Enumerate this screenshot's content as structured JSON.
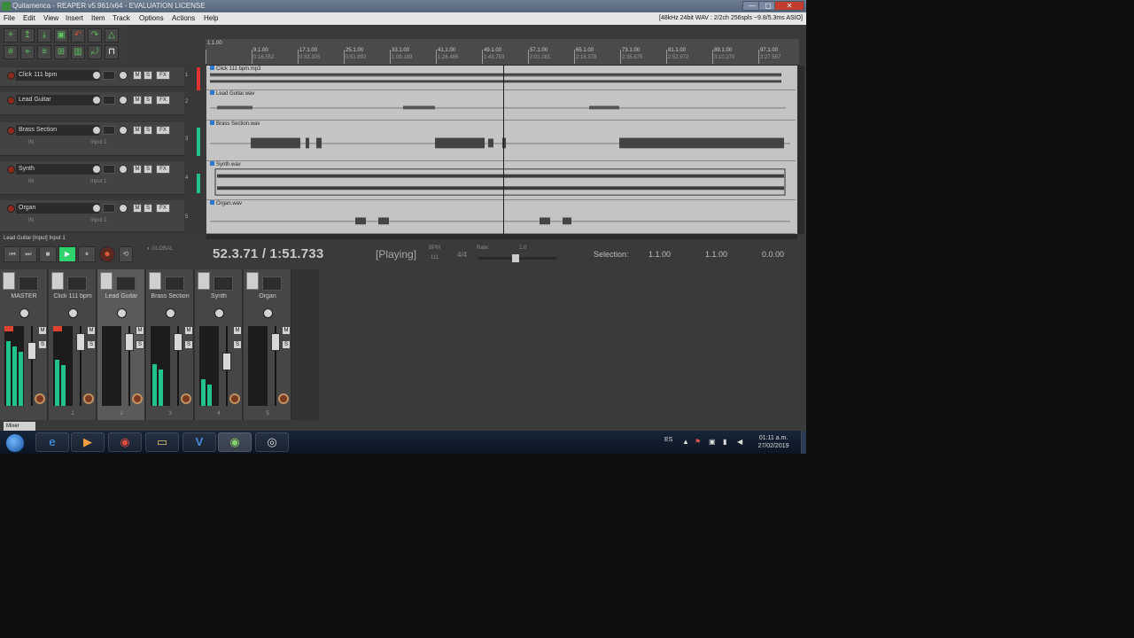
{
  "window": {
    "title": "Quitamenca - REAPER v5.961/x64 - EVALUATION LICENSE",
    "audio_status": "[48kHz 24bit WAV : 2/2ch 256spls ~9.8/5.3ms ASIO]",
    "min_glyph": "—",
    "max_glyph": "▢",
    "close_glyph": "✕"
  },
  "menu": [
    "File",
    "Edit",
    "View",
    "Insert",
    "Item",
    "Track",
    "Options",
    "Actions",
    "Help"
  ],
  "ruler": {
    "marks": [
      {
        "bar": "1.1.00",
        "time": "0:00.000"
      },
      {
        "bar": "9.1.00",
        "time": "0:16.552"
      },
      {
        "bar": "17.1.00",
        "time": "0:33.305"
      },
      {
        "bar": "25.1.00",
        "time": "0:51.892"
      },
      {
        "bar": "33.1.00",
        "time": "1:09.189"
      },
      {
        "bar": "41.1.00",
        "time": "1:26.486"
      },
      {
        "bar": "49.1.00",
        "time": "1:43.783"
      },
      {
        "bar": "57.1.00",
        "time": "2:01.081"
      },
      {
        "bar": "65.1.00",
        "time": "2:18.378"
      },
      {
        "bar": "73.1.00",
        "time": "2:35.675"
      },
      {
        "bar": "81.1.00",
        "time": "2:52.972"
      },
      {
        "bar": "89.1.00",
        "time": "3:10.270"
      },
      {
        "bar": "97.1.00",
        "time": "3:27.567"
      }
    ]
  },
  "tracks": [
    {
      "name": "Click 111 bpm",
      "number": "1",
      "item": "Click 111 bpm.mp3"
    },
    {
      "name": "Lead Guitar",
      "number": "2",
      "item": "Lead Guitar.wav"
    },
    {
      "name": "Brass Section",
      "number": "3",
      "item": "Brass Section.wav"
    },
    {
      "name": "Synth",
      "number": "4",
      "item": "Synth.wav"
    },
    {
      "name": "Organ",
      "number": "5",
      "item": "Organ.wav"
    }
  ],
  "tcp": {
    "mute": "M",
    "solo": "S",
    "fx": "FX",
    "input_label": "Input 1",
    "in_label": "IN",
    "status": "Lead Guitar [Input] Input 1"
  },
  "transport": {
    "time": "52.3.71 / 1:51.733",
    "state": "[Playing]",
    "bpm_label": "BPM",
    "bpm_value": "111",
    "time_sig": "4/4",
    "rate_label": "Rate:",
    "rate_value": "1.0",
    "selection_label": "Selection:",
    "sel_start": "1.1.00",
    "sel_end": "1.1.00",
    "sel_length": "0.0.00",
    "rewind": "⏮",
    "forward": "⏭",
    "stop": "■",
    "play": "▶",
    "pause": "⏸",
    "record": "●",
    "loop": "⟲"
  },
  "mixer": {
    "strips": [
      {
        "name": "MASTER",
        "number": "",
        "level": 0.85
      },
      {
        "name": "Click 111 bpm",
        "number": "1",
        "level": 0.6
      },
      {
        "name": "Lead Guitar",
        "number": "2",
        "level": 0.0
      },
      {
        "name": "Brass Section",
        "number": "3",
        "level": 0.55
      },
      {
        "name": "Synth",
        "number": "4",
        "level": 0.35
      },
      {
        "name": "Organ",
        "number": "5",
        "level": 0.0
      }
    ],
    "mute": "M",
    "solo": "S",
    "tab_label": "Mixer"
  },
  "taskbar": {
    "lang": "ES",
    "time": "01:11 a.m.",
    "date": "27/02/2019",
    "apps": [
      "e",
      "▶",
      "◉",
      "▭",
      "V",
      "◉",
      "◎"
    ]
  },
  "colors": {
    "play_active": "#2ed36c",
    "meter": "#22c38a",
    "clip": "#e0422f",
    "item_label": "#2b79c9"
  }
}
